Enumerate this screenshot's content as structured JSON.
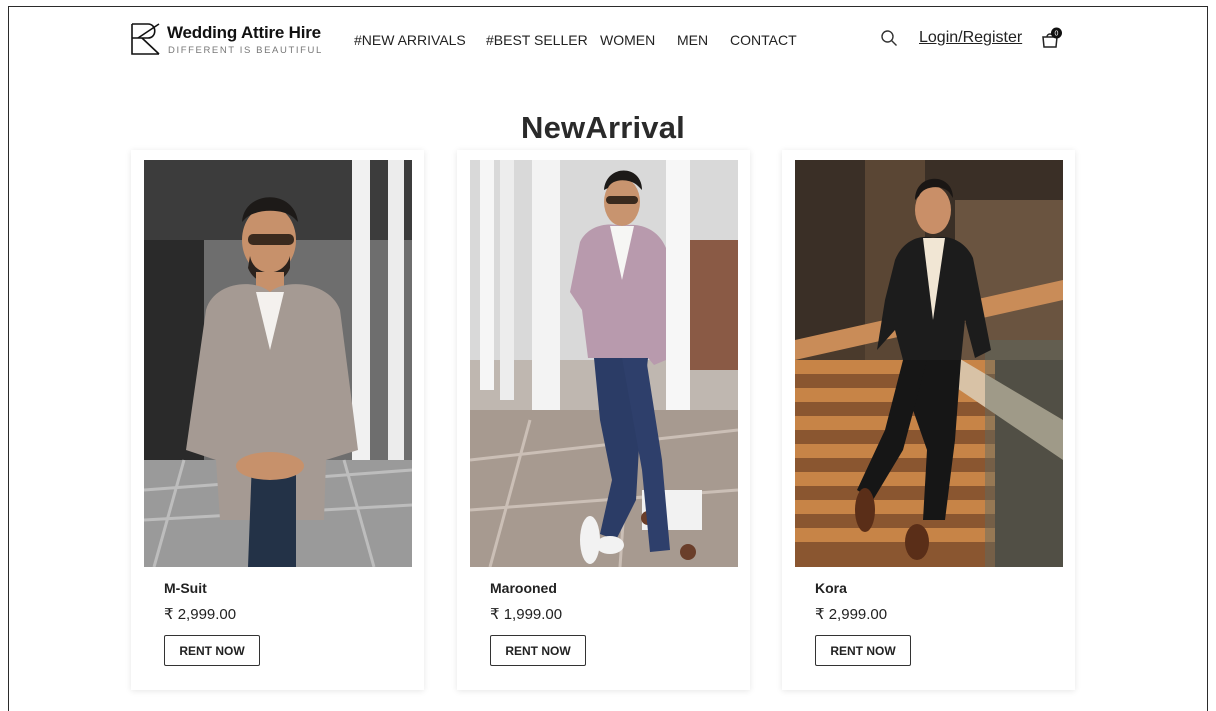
{
  "brand": {
    "name": "Wedding Attire Hire",
    "tagline": "DIFFERENT IS BEAUTIFUL"
  },
  "nav": {
    "items": [
      "#NEW ARRIVALS",
      "#BEST SELLER",
      "WOMEN",
      "MEN",
      "CONTACT"
    ]
  },
  "header": {
    "login_label": "Login/Register",
    "cart_count": "0"
  },
  "section": {
    "title": "NewArrival"
  },
  "products": [
    {
      "name": "M-Suit",
      "price": "₹ 2,999.00",
      "button": "RENT NOW"
    },
    {
      "name": "Marooned",
      "price": "₹ 1,999.00",
      "button": "RENT NOW"
    },
    {
      "name": "Kora",
      "price": "₹ 2,999.00",
      "button": "RENT NOW"
    }
  ],
  "colors": {
    "text": "#222222",
    "card_border": "#e6e6e6"
  }
}
